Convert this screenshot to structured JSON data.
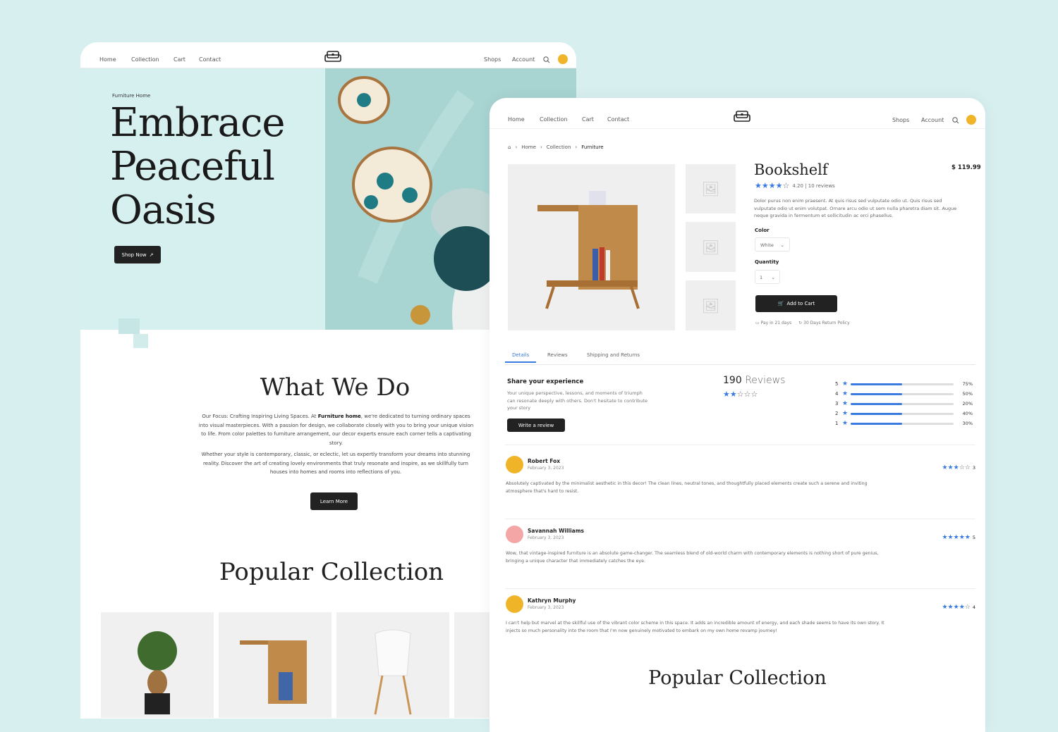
{
  "nav": {
    "home": "Home",
    "collection": "Collection",
    "cart": "Cart",
    "contact": "Contact",
    "shops": "Shops",
    "account": "Account"
  },
  "landing": {
    "eyebrow": "Furniture Home",
    "hero_lines": [
      "Embrace",
      "Peaceful",
      "Oasis"
    ],
    "shop_now": "Shop Now",
    "what_title": "What We Do",
    "para1_a": "Our Focus: Crafting Inspiring Living Spaces. At ",
    "para1_brand": "Furniture home",
    "para1_b": ", we're dedicated to turning ordinary spaces into visual masterpieces. With a passion for design, we collaborate closely with you to bring your unique vision to life. From color palettes to furniture arrangement, our decor experts ensure each corner tells a captivating story.",
    "para2": "Whether your style is contemporary, classic, or eclectic, let us expertly transform your dreams into stunning reality. Discover the art of creating lovely environments that truly resonate and inspire, as we skillfully turn houses into homes and rooms into reflections of you.",
    "learn_more": "Learn More",
    "popular_title": "Popular Collection"
  },
  "product": {
    "breadcrumb": [
      "Home",
      "Collection",
      "Furniture"
    ],
    "name": "Bookshelf",
    "price": "$ 119.99",
    "rating": 4,
    "rating_text": "4.20 | 10 reviews",
    "description": "Dolor purus non enim praesent. At quis risus sed vulputate odio ut. Quis risus sed vulputate odio ut enim volutpat. Ornare arcu odio ut sem nulla pharetra diam sit. Augue neque gravida in fermentum et sollicitudin ac orci phasellus.",
    "color_label": "Color",
    "color_value": "White",
    "quantity_label": "Quantity",
    "quantity_value": "1",
    "add_to_cart": "Add to Cart",
    "pay": "Pay in 21 days",
    "returns": "30 Days Return Policy",
    "tabs": [
      "Details",
      "Reviews",
      "Shipping and Returns"
    ],
    "share_title": "Share your experience",
    "share_text": "Your unique perspective, lessons, and moments of triumph can resonate deeply with others. Don't hesitate to contribute your story",
    "write_review": "Write a review",
    "reviews_count": "190",
    "reviews_word": "Reviews",
    "summary_rating": 2,
    "distribution": [
      {
        "star": "5",
        "pct": "75%",
        "fill": 0.5
      },
      {
        "star": "4",
        "pct": "50%",
        "fill": 0.5
      },
      {
        "star": "3",
        "pct": "20%",
        "fill": 0.5
      },
      {
        "star": "2",
        "pct": "40%",
        "fill": 0.5
      },
      {
        "star": "1",
        "pct": "30%",
        "fill": 0.5
      }
    ],
    "reviews": [
      {
        "name": "Robert Fox",
        "date": "February 3, 2023",
        "rating": 3,
        "score": "3",
        "text": "Absolutely captivated by the minimalist aesthetic in this decor! The clean lines, neutral tones, and thoughtfully placed elements create such a serene and inviting atmosphere that's hard to resist."
      },
      {
        "name": "Savannah Williams",
        "date": "February 3, 2023",
        "rating": 5,
        "score": "5",
        "text": "Wow, that vintage-inspired furniture is an absolute game-changer. The seamless blend of old-world charm with contemporary elements is nothing short of pure genius, bringing a unique character that immediately catches the eye."
      },
      {
        "name": "Kathryn Murphy",
        "date": "February 3, 2023",
        "rating": 4,
        "score": "4",
        "text": "I can't help but marvel at the skillful use of the vibrant color scheme in this space. It adds an incredible amount of energy, and each shade seems to have its own story. It injects so much personality into the room that I'm now genuinely motivated to embark on my own home revamp journey!"
      }
    ],
    "popular_title": "Popular Collection"
  },
  "colors": {
    "accent": "#3a7be0",
    "bg": "#d8efef",
    "dark": "#222222"
  }
}
